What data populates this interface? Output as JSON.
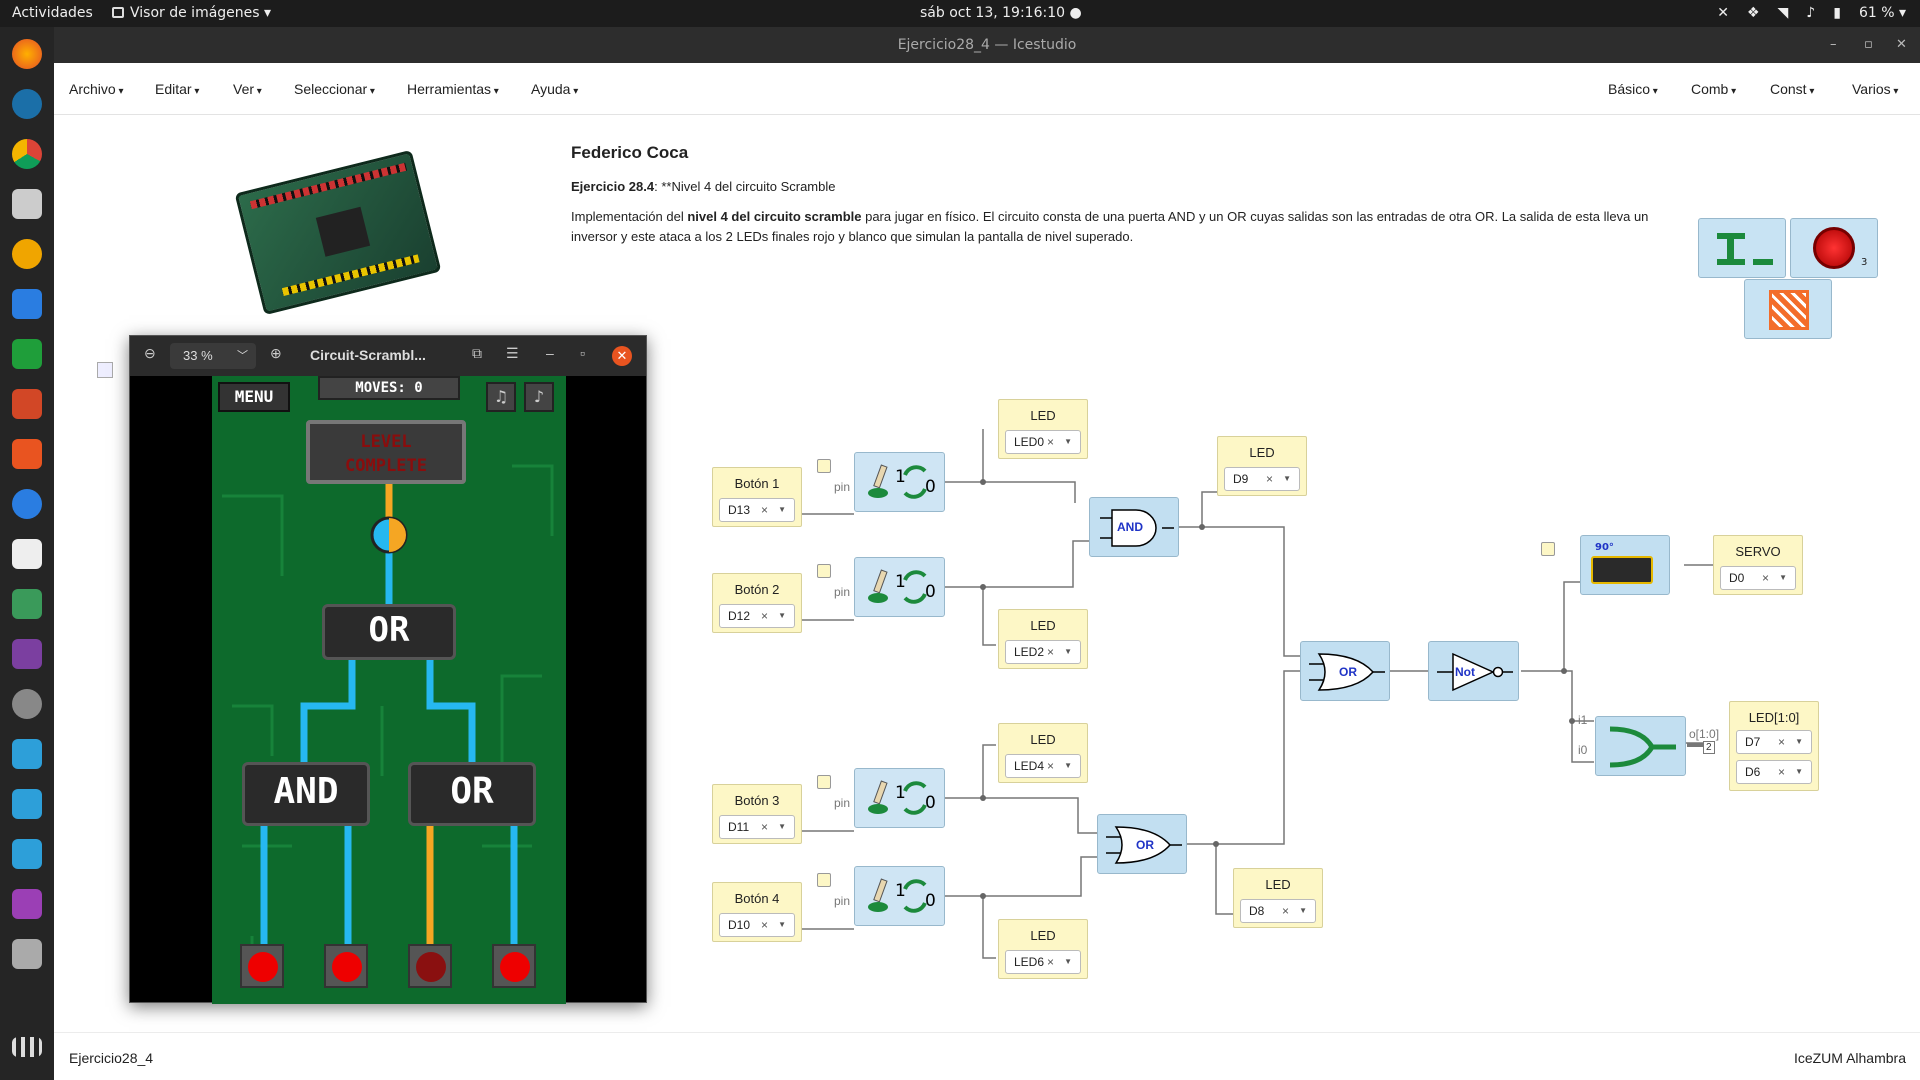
{
  "system": {
    "activities": "Actividades",
    "app_menu": "Visor de imágenes ▾",
    "clock": "sáb oct 13, 19:16:10 ●",
    "battery": "61 % ▾"
  },
  "window": {
    "title": "Ejercicio28_4 — Icestudio"
  },
  "menu": {
    "left": [
      "Archivo",
      "Editar",
      "Ver",
      "Seleccionar",
      "Herramientas",
      "Ayuda"
    ],
    "right": [
      "Básico",
      "Comb",
      "Const",
      "Varios"
    ]
  },
  "info": {
    "author": "Federico Coca",
    "exercise_label": "Ejercicio 28.4",
    "exercise_rest": ": **Nivel 4 del circuito Scramble",
    "desc_pre": "Implementación del ",
    "desc_bold": "nivel 4 del circuito scramble",
    "desc_post": " para jugar en físico. El circuito consta de una puerta AND y un OR cuyas salidas son las entradas de otra OR. La salida de esta lleva un inversor y este ataca a los 2 LEDs finales rojo y blanco que simulan la pantalla de nivel superado."
  },
  "blocks": {
    "btn1": {
      "title": "Botón 1",
      "value": "D13"
    },
    "btn2": {
      "title": "Botón 2",
      "value": "D12"
    },
    "btn3": {
      "title": "Botón 3",
      "value": "D11"
    },
    "btn4": {
      "title": "Botón 4",
      "value": "D10"
    },
    "led0": {
      "title": "LED",
      "value": "LED0"
    },
    "led2": {
      "title": "LED",
      "value": "LED2"
    },
    "led4": {
      "title": "LED",
      "value": "LED4"
    },
    "led6": {
      "title": "LED",
      "value": "LED6"
    },
    "d9": {
      "title": "LED",
      "value": "D9"
    },
    "d8": {
      "title": "LED",
      "value": "D8"
    },
    "servo": {
      "title": "SERVO",
      "value": "D0"
    },
    "ledbus": {
      "title": "LED[1:0]",
      "value1": "D7",
      "value2": "D6"
    }
  },
  "gates": {
    "and": "AND",
    "or_top": "OR",
    "or_bottom": "OR",
    "not": "Not"
  },
  "labels": {
    "pin": "pin",
    "one": "1",
    "zero": "0",
    "i1": "i1",
    "i0": "i0",
    "bus_out": "o[1:0]",
    "bus_width": "2",
    "servo_angle": "90°",
    "badge": "3",
    "clear": "×"
  },
  "viewer": {
    "zoom": "33 %",
    "title": "Circuit-Scrambl...",
    "game": {
      "menu": "MENU",
      "moves": "MOVES: 0",
      "level_line1": "LEVEL",
      "level_line2": "COMPLETE",
      "chip_top": "OR",
      "chip_left": "AND",
      "chip_right": "OR"
    }
  },
  "status": {
    "left": "Ejercicio28_4",
    "right": "IceZUM Alhambra"
  },
  "colors": {
    "block_yellow": "#fdf7c6",
    "gate_blue": "#c2dff1",
    "board_green": "#0d6a2c",
    "wire_blue": "#26b8f0",
    "wire_orange": "#f5a623"
  }
}
